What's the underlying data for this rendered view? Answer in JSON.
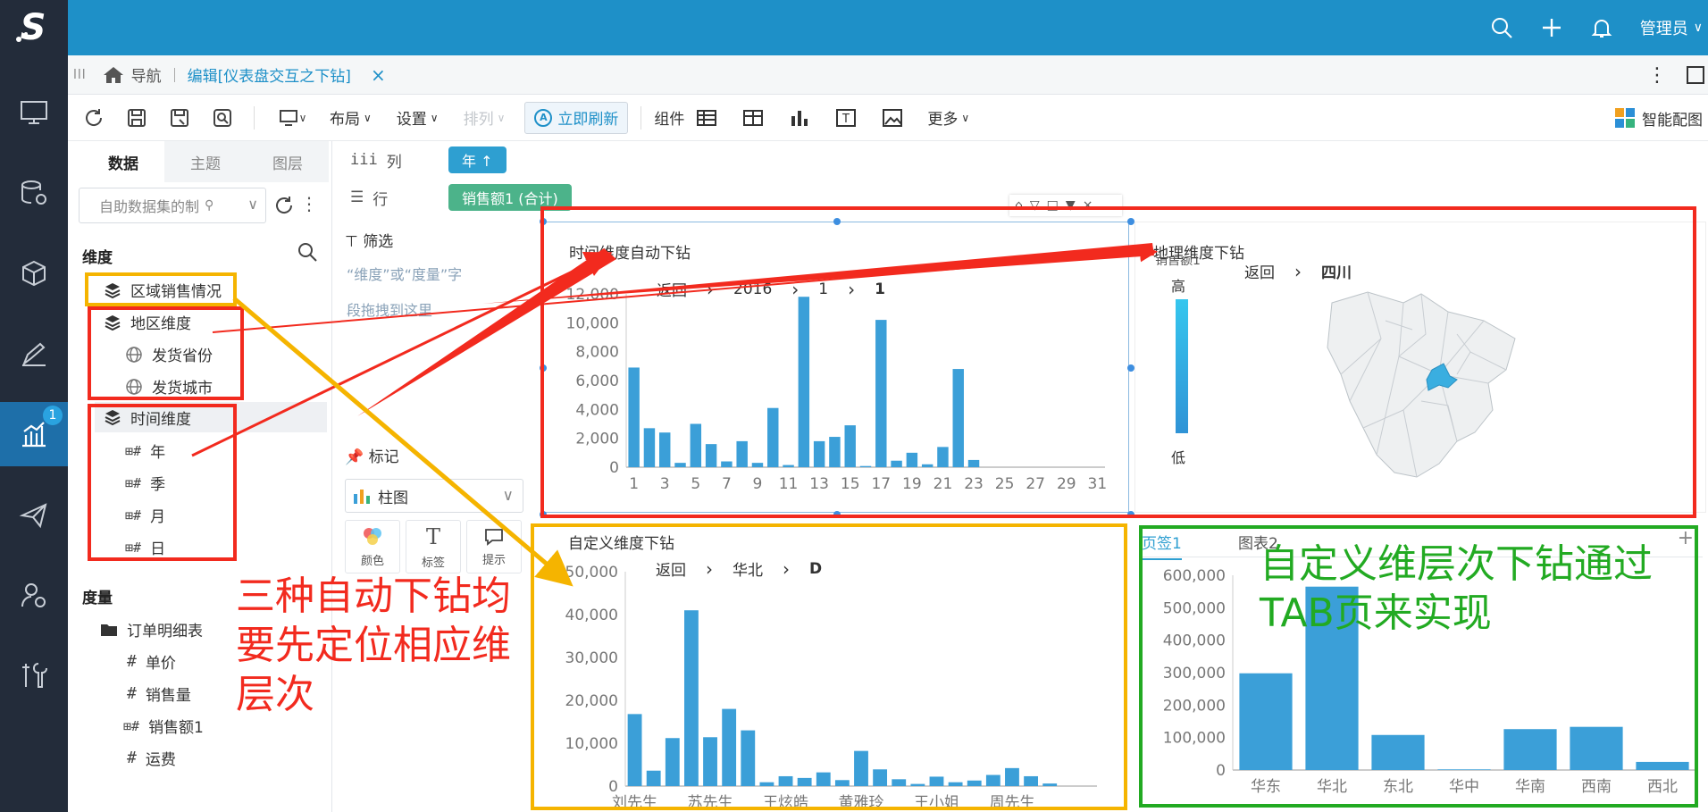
{
  "app": {
    "logo": "S",
    "user": "管理员"
  },
  "leftbar": {
    "items": [
      "monitor-icon",
      "database-settings-icon",
      "cube-icon",
      "pen-icon",
      "chart-icon",
      "send-icon",
      "user-gear-icon",
      "tools-icon"
    ],
    "badge": "1"
  },
  "tabs": {
    "home_label": "导航",
    "active_tab": "编辑[仪表盘交互之下钻]",
    "close": "×"
  },
  "toolbar": {
    "layout": "布局",
    "settings": "设置",
    "arrange": "排列",
    "refresh": "立即刷新",
    "component": "组件",
    "more": "更多",
    "smart_layout": "智能配图",
    "refresh_letter": "A"
  },
  "left_panel": {
    "tabs": [
      "数据",
      "主题",
      "图层"
    ],
    "dataset_placeholder": "自助数据集的制",
    "dimension_title": "维度",
    "dimensions": [
      {
        "label": "区域销售情况"
      },
      {
        "label": "地区维度"
      },
      {
        "label": "发货省份"
      },
      {
        "label": "发货城市"
      },
      {
        "label": "时间维度"
      },
      {
        "label": "年"
      },
      {
        "label": "季"
      },
      {
        "label": "月"
      },
      {
        "label": "日"
      }
    ],
    "measure_title": "度量",
    "measures": [
      {
        "label": "订单明细表"
      },
      {
        "label": "单价"
      },
      {
        "label": "销售量"
      },
      {
        "label": "销售额1"
      },
      {
        "label": "运费"
      }
    ],
    "hash": "#",
    "hash_date": "⊞#"
  },
  "shelf": {
    "col_label": "列",
    "row_label": "行",
    "col_pill": "年 ↑",
    "row_pill": "销售额1 (合计)"
  },
  "mid_panel": {
    "filter_title": "筛选",
    "filter_hint_1": "“维度”或“度量”字",
    "filter_hint_2": "段拖拽到这里",
    "mark_title": "标记",
    "chart_type": "柱图",
    "marks": [
      "颜色",
      "标签",
      "提示"
    ]
  },
  "widgets": {
    "time": {
      "title": "时间维度自动下钻",
      "crumbs": [
        "返回",
        "2016",
        "1",
        "1"
      ]
    },
    "geo": {
      "title": "地理维度下钻",
      "legend_cut": "销售额1",
      "legend_high": "高",
      "legend_low": "低",
      "crumbs": [
        "返回",
        "四川"
      ]
    },
    "custom": {
      "title": "自定义维度下钻",
      "crumbs": [
        "返回",
        "华北",
        "D"
      ]
    },
    "tab": {
      "tabs": [
        "页签1",
        "图表2"
      ],
      "plus": "+"
    }
  },
  "annotations": {
    "red": [
      "三种自动下钻均",
      "要先定位相应维",
      "层次"
    ],
    "green": [
      "自定义维层次下钻通过",
      "TAB页来实现"
    ],
    "colors": {
      "red": "#f22a1e",
      "yellow": "#f5b400",
      "green": "#22aa22"
    }
  },
  "chart_data": [
    {
      "type": "bar",
      "title": "时间维度自动下钻",
      "x": [
        1,
        2,
        3,
        4,
        5,
        6,
        7,
        8,
        9,
        10,
        11,
        12,
        13,
        14,
        15,
        16,
        17,
        18,
        19,
        20,
        21,
        22,
        23,
        24,
        25,
        26,
        27,
        28,
        29,
        30,
        31
      ],
      "x_tick_labels": [
        "1",
        "3",
        "5",
        "7",
        "9",
        "11",
        "13",
        "15",
        "17",
        "19",
        "21",
        "23",
        "25",
        "27",
        "29",
        "31"
      ],
      "values": [
        6900,
        2700,
        2400,
        300,
        3000,
        1600,
        400,
        1800,
        300,
        4100,
        150,
        11800,
        1800,
        2100,
        2900,
        80,
        10200,
        450,
        1000,
        200,
        1400,
        6800,
        500,
        0,
        0,
        0,
        0,
        0,
        0,
        0,
        0
      ],
      "ylim": [
        0,
        12000
      ],
      "y_ticks": [
        "0",
        "2,000",
        "4,000",
        "6,000",
        "8,000",
        "10,000",
        "12,000"
      ],
      "color": "#3b9fd8"
    },
    {
      "type": "bar",
      "title": "自定义维度下钻",
      "categories": [
        "刘先生",
        "",
        "",
        "",
        "苏先生",
        "",
        "",
        "",
        "王炫皓",
        "",
        "",
        "",
        "黄雅玲",
        "",
        "",
        "",
        "王小姐",
        "",
        "",
        "",
        "周先生",
        "",
        "",
        "",
        ""
      ],
      "values": [
        16800,
        3600,
        11200,
        41000,
        11400,
        18000,
        13000,
        900,
        2300,
        1900,
        3200,
        1400,
        8200,
        3900,
        1600,
        500,
        2200,
        900,
        1300,
        2600,
        4200,
        2300,
        600,
        0,
        0
      ],
      "ylim": [
        0,
        50000
      ],
      "y_ticks": [
        "0",
        "10,000",
        "20,000",
        "30,000",
        "40,000",
        "50,000"
      ],
      "color": "#3b9fd8"
    },
    {
      "type": "bar",
      "title": "页签1",
      "categories": [
        "华东",
        "华北",
        "东北",
        "华中",
        "华南",
        "西南",
        "西北"
      ],
      "values": [
        298000,
        565000,
        108000,
        2000,
        126000,
        133000,
        25000
      ],
      "ylim": [
        0,
        600000
      ],
      "y_ticks": [
        "0",
        "100,000",
        "200,000",
        "300,000",
        "400,000",
        "500,000",
        "600,000"
      ],
      "color": "#3b9fd8"
    }
  ]
}
